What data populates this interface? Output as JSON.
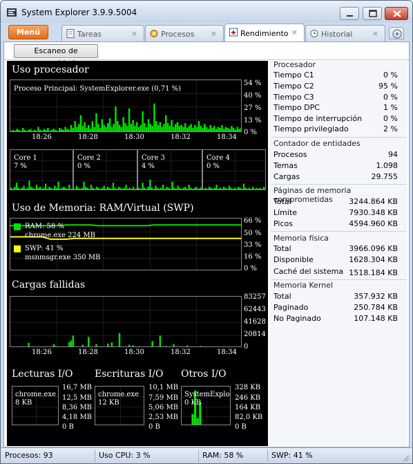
{
  "window": {
    "title": "System Explorer 3.9.9.5004"
  },
  "menu_label": "Menú",
  "tabs": [
    {
      "label": "Tareas",
      "close": "×"
    },
    {
      "label": "Procesos",
      "close": "×"
    },
    {
      "label": "Rendimiento",
      "close": "×"
    },
    {
      "label": "Historial",
      "close": "×"
    }
  ],
  "toolbar": {
    "scan_label": "Escaneo de seguridad"
  },
  "cpu": {
    "heading": "Uso procesador",
    "label": "Proceso Principal: SystemExplorer.exe (0,71 %)",
    "y_ticks": [
      "54 %",
      "40 %",
      "27 %",
      "13 %",
      "0 %"
    ],
    "x_ticks": [
      "18:26",
      "18:28",
      "18:30",
      "18:32",
      "18:34"
    ],
    "series_color": "#00e000",
    "values": [
      2,
      3,
      2,
      4,
      3,
      2,
      5,
      3,
      2,
      3,
      4,
      2,
      3,
      2,
      6,
      3,
      2,
      4,
      3,
      5,
      2,
      3,
      4,
      3,
      2,
      5,
      4,
      3,
      6,
      4,
      3,
      8,
      5,
      12,
      6,
      9,
      18,
      7,
      11,
      5,
      8,
      4,
      12,
      6,
      20,
      9,
      5,
      14,
      8,
      6,
      10,
      15,
      6,
      9,
      27,
      12,
      8,
      6,
      16,
      10,
      7,
      25,
      9,
      13,
      7,
      11,
      6,
      8,
      22,
      10,
      6,
      14,
      9,
      7,
      30,
      12,
      8,
      11,
      6,
      9,
      18,
      10,
      7,
      13,
      6,
      9,
      11,
      7,
      8,
      6,
      10,
      5,
      7,
      9,
      5,
      8,
      6,
      12,
      7,
      5,
      9,
      6,
      4,
      8,
      5,
      7,
      4,
      6,
      5,
      8,
      4,
      6,
      5,
      4,
      7,
      5,
      3,
      6,
      4,
      5
    ]
  },
  "cores": [
    {
      "label": "Core 1",
      "value": "7 %",
      "values": [
        3,
        2,
        4,
        8,
        3,
        2,
        3,
        5,
        2,
        3,
        10,
        4,
        3,
        2,
        6,
        3,
        4,
        2,
        3,
        7,
        2,
        4,
        3,
        2,
        5,
        3,
        9,
        2,
        3,
        4,
        3,
        2,
        6,
        2,
        3
      ]
    },
    {
      "label": "Core 2",
      "value": "0 %",
      "values": [
        2,
        5,
        3,
        2,
        3,
        9,
        4,
        3,
        2,
        6,
        3,
        2,
        4,
        3,
        2,
        3,
        5,
        2,
        4,
        3,
        2,
        8,
        3,
        2,
        4,
        3,
        2,
        3,
        6,
        2,
        3,
        2,
        4,
        2,
        3
      ]
    },
    {
      "label": "Core 3",
      "value": "4 %",
      "values": [
        3,
        2,
        8,
        3,
        2,
        4,
        11,
        3,
        2,
        5,
        3,
        2,
        3,
        6,
        2,
        4,
        3,
        2,
        9,
        3,
        2,
        5,
        3,
        2,
        3,
        4,
        2,
        6,
        3,
        2,
        3,
        4,
        2,
        3,
        4
      ]
    },
    {
      "label": "Core 4",
      "value": "0 %",
      "values": [
        2,
        3,
        2,
        4,
        3,
        2,
        3,
        6,
        2,
        3,
        2,
        4,
        3,
        2,
        5,
        3,
        2,
        3,
        2,
        4,
        3,
        2,
        7,
        3,
        2,
        3,
        2,
        4,
        2,
        3,
        2,
        3,
        2,
        4,
        3
      ]
    }
  ],
  "memory": {
    "heading": "Uso de Memoria: RAM/Virtual (SWP)",
    "ram_label": "RAM: 58 %",
    "ram_proc": "chrome.exe 224 MB",
    "ram_color": "#00e000",
    "swp_label": "SWP: 41 %",
    "swp_proc": "msnmsgr.exe 350 MB",
    "swp_color": "#ffff00",
    "y_ticks": [
      "66 %",
      "50 %",
      "33 %",
      "16 %",
      "0 %"
    ],
    "ram_values": [
      57,
      57,
      57,
      57,
      57,
      57,
      57,
      58,
      58,
      58,
      58,
      57,
      57,
      57,
      57,
      57,
      57,
      57,
      58,
      58,
      58,
      58,
      58,
      58,
      58,
      58,
      58,
      58,
      58,
      58
    ],
    "swp_values": [
      43,
      43,
      43,
      43,
      43,
      40,
      40,
      40,
      41,
      41,
      41,
      41,
      41,
      41,
      41,
      41,
      41,
      41,
      41,
      41,
      41,
      41,
      41,
      41,
      41,
      41,
      41,
      41,
      41,
      41
    ]
  },
  "pagefaults": {
    "heading": "Cargas fallidas",
    "y_ticks": [
      "83257",
      "62443",
      "41628",
      "20814",
      "0"
    ],
    "x_ticks": [
      "18:26",
      "18:28",
      "18:30",
      "18:32",
      "18:34"
    ],
    "values": [
      0,
      0,
      0,
      0,
      0,
      0,
      0,
      0,
      0,
      8000,
      0,
      0,
      0,
      0,
      0,
      0,
      0,
      0,
      0,
      0,
      0,
      0,
      6000,
      3000,
      0,
      0,
      0,
      0,
      0,
      0,
      9000,
      12000,
      20000,
      0,
      0,
      0,
      0,
      5000,
      0,
      0,
      18000,
      0,
      0,
      0,
      6000,
      0,
      0,
      0,
      0,
      0,
      7000,
      0,
      9000,
      0,
      0,
      0,
      24000,
      0,
      0,
      0,
      0,
      5000,
      0,
      4000,
      0,
      0,
      0,
      0,
      0,
      0,
      0,
      0,
      0,
      11000,
      0,
      0,
      0,
      20000,
      2000,
      0,
      3000,
      0,
      0,
      0,
      6000,
      0,
      0,
      0,
      0,
      0,
      0,
      4000,
      0,
      0,
      0,
      0,
      0,
      0,
      3000,
      0,
      0,
      0,
      0,
      0,
      0,
      0,
      0,
      0,
      0,
      0,
      0,
      0,
      0,
      0,
      0,
      0,
      0,
      0,
      0,
      0
    ]
  },
  "io": [
    {
      "heading": "Lecturas I/O",
      "proc": "chrome.exe",
      "value": "8 KB",
      "y_ticks": [
        "16,7 MB",
        "12,5 MB",
        "8,36 MB",
        "4,18 MB",
        "0 B"
      ],
      "values": [
        0,
        0,
        0,
        0,
        0,
        0,
        0,
        0,
        0,
        0,
        0,
        0,
        0,
        0,
        0,
        0,
        0,
        0,
        0,
        0
      ]
    },
    {
      "heading": "Escrituras I/O",
      "proc": "chrome.exe",
      "value": "12 KB",
      "y_ticks": [
        "10,1 MB",
        "7,59 MB",
        "5,06 MB",
        "2,53 MB",
        "0 B"
      ],
      "values": [
        0,
        0,
        0,
        0,
        0,
        0,
        0,
        0,
        0,
        0,
        0,
        0,
        0,
        0,
        0,
        0,
        0,
        0,
        0,
        0
      ]
    },
    {
      "heading": "Otros I/O",
      "proc": "SystemExplor",
      "value": "0 KB",
      "y_ticks": [
        "328 KB",
        "246 KB",
        "164 KB",
        "82,0 KB",
        "0 B"
      ],
      "values": [
        0,
        0,
        0,
        0,
        30,
        90,
        20,
        60,
        0,
        0,
        0,
        0,
        0,
        0,
        0,
        0,
        0,
        0,
        0,
        0
      ]
    }
  ],
  "stats": {
    "processor": {
      "title": "Procesador",
      "rows": [
        {
          "k": "Tiempo C1",
          "v": "0 %"
        },
        {
          "k": "Tiempo C2",
          "v": "95 %"
        },
        {
          "k": "Tiempo C3",
          "v": "0 %"
        },
        {
          "k": "Tiempo DPC",
          "v": "1 %"
        },
        {
          "k": "Tiempo de interrupción",
          "v": "0 %"
        },
        {
          "k": "Tiempo privilegiado",
          "v": "2 %"
        }
      ]
    },
    "entities": {
      "title": "Contador de entidades",
      "rows": [
        {
          "k": "Procesos",
          "v": "94"
        },
        {
          "k": "Temas",
          "v": "1.098"
        },
        {
          "k": "Cargas",
          "v": "29.755"
        }
      ]
    },
    "committed": {
      "title": "Páginas de memoria comprometidas",
      "rows": [
        {
          "k": "Total",
          "v": "3244.864 KB"
        },
        {
          "k": "Límite",
          "v": "7930.348 KB"
        },
        {
          "k": "Picos",
          "v": "4594.960 KB"
        }
      ]
    },
    "physical": {
      "title": "Memoria física",
      "rows": [
        {
          "k": "Total",
          "v": "3966.096 KB"
        },
        {
          "k": "Disponible",
          "v": "1628.304 KB"
        },
        {
          "k": "Caché del sistema",
          "v": "1518.184 KB"
        }
      ]
    },
    "kernel": {
      "title": "Memoria Kernel",
      "rows": [
        {
          "k": "Total",
          "v": "357.932 KB"
        },
        {
          "k": "Paginado",
          "v": "250.784 KB"
        },
        {
          "k": "No Paginado",
          "v": "107.148 KB"
        }
      ]
    }
  },
  "status": {
    "procesos": "Procesos: 93",
    "cpu": "Uso CPU: 3 %",
    "ram": "RAM: 58 %",
    "swp": "SWP: 41 %"
  }
}
